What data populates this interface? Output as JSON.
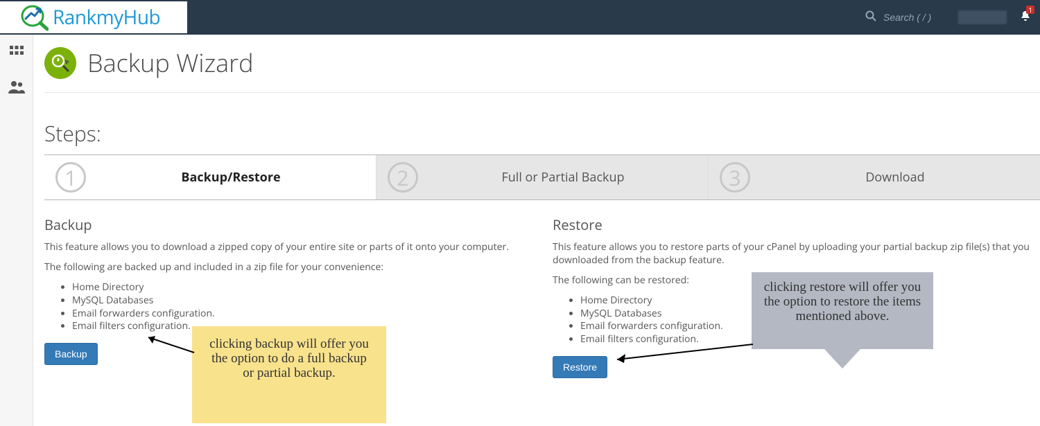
{
  "header": {
    "logo_text": "RankmyHub",
    "search_placeholder": "Search ( / )",
    "notification_count": "1"
  },
  "page": {
    "title": "Backup Wizard",
    "steps_label": "Steps:"
  },
  "steps": [
    {
      "num": "1",
      "label": "Backup/Restore"
    },
    {
      "num": "2",
      "label": "Full or Partial Backup"
    },
    {
      "num": "3",
      "label": "Download"
    }
  ],
  "backup": {
    "heading": "Backup",
    "desc": "This feature allows you to download a zipped copy of your entire site or parts of it onto your computer.",
    "list_intro": "The following are backed up and included in a zip file for your convenience:",
    "items": [
      "Home Directory",
      "MySQL Databases",
      "Email forwarders configuration.",
      "Email filters configuration."
    ],
    "button": "Backup",
    "callout": "clicking backup will offer you the option to do a full backup or partial backup."
  },
  "restore": {
    "heading": "Restore",
    "desc": "This feature allows you to restore parts of your cPanel by uploading your partial backup zip file(s) that you downloaded from the backup feature.",
    "list_intro": "The following can be restored:",
    "items": [
      "Home Directory",
      "MySQL Databases",
      "Email forwarders configuration.",
      "Email filters configuration."
    ],
    "button": "Restore",
    "callout": "clicking restore will offer you the option to restore the items mentioned above."
  }
}
